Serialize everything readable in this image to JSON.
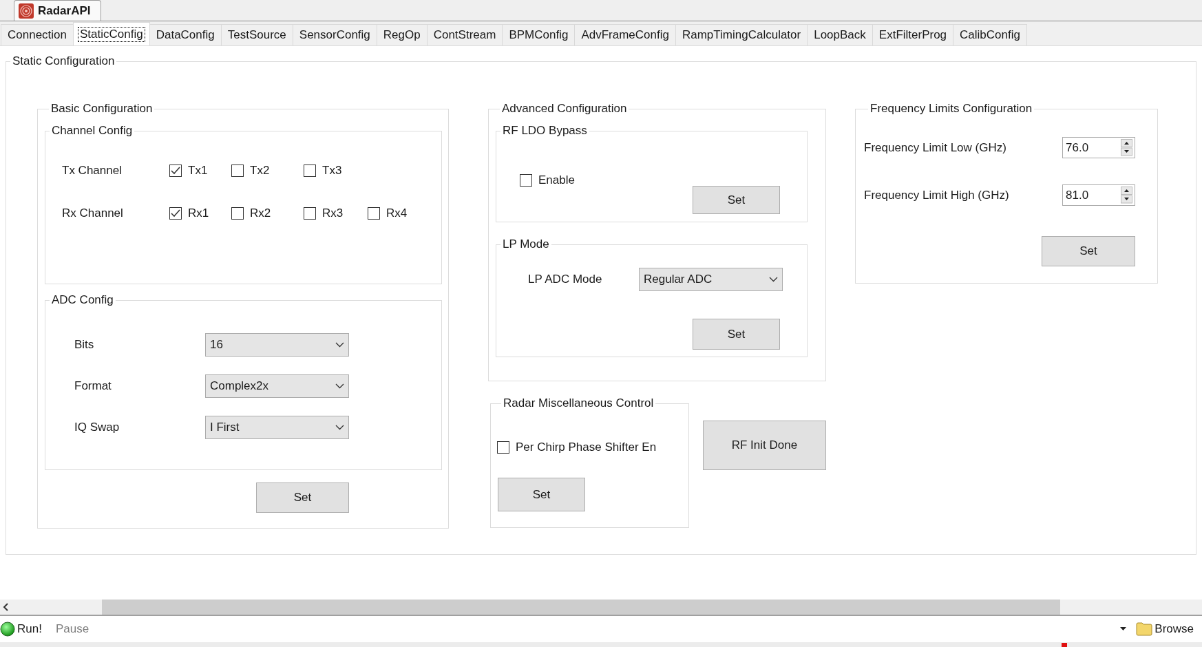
{
  "document_tab": {
    "title": "RadarAPI"
  },
  "tabs": [
    {
      "label": "Connection",
      "selected": false
    },
    {
      "label": "StaticConfig",
      "selected": true
    },
    {
      "label": "DataConfig",
      "selected": false
    },
    {
      "label": "TestSource",
      "selected": false
    },
    {
      "label": "SensorConfig",
      "selected": false
    },
    {
      "label": "RegOp",
      "selected": false
    },
    {
      "label": "ContStream",
      "selected": false
    },
    {
      "label": "BPMConfig",
      "selected": false
    },
    {
      "label": "AdvFrameConfig",
      "selected": false
    },
    {
      "label": "RampTimingCalculator",
      "selected": false
    },
    {
      "label": "LoopBack",
      "selected": false
    },
    {
      "label": "ExtFilterProg",
      "selected": false
    },
    {
      "label": "CalibConfig",
      "selected": false
    }
  ],
  "static_configuration": {
    "title": "Static Configuration",
    "basic_configuration": {
      "title": "Basic Configuration",
      "channel_config": {
        "title": "Channel Config",
        "rows": [
          {
            "label": "Tx Channel",
            "channels": [
              {
                "label": "Tx1",
                "checked": true
              },
              {
                "label": "Tx2",
                "checked": false
              },
              {
                "label": "Tx3",
                "checked": false
              }
            ]
          },
          {
            "label": "Rx Channel",
            "channels": [
              {
                "label": "Rx1",
                "checked": true
              },
              {
                "label": "Rx2",
                "checked": false
              },
              {
                "label": "Rx3",
                "checked": false
              },
              {
                "label": "Rx4",
                "checked": false
              }
            ]
          }
        ]
      },
      "adc_config": {
        "title": "ADC Config",
        "fields": [
          {
            "label": "Bits",
            "value": "16"
          },
          {
            "label": "Format",
            "value": "Complex2x"
          },
          {
            "label": "IQ Swap",
            "value": "I First"
          }
        ]
      },
      "set_button": "Set"
    },
    "advanced_configuration": {
      "title": "Advanced Configuration",
      "rf_ldo_bypass": {
        "title": "RF LDO Bypass",
        "enable": {
          "label": "Enable",
          "checked": false
        },
        "set_button": "Set"
      },
      "lp_mode": {
        "title": "LP Mode",
        "field": {
          "label": "LP ADC Mode",
          "value": "Regular ADC"
        },
        "set_button": "Set"
      }
    },
    "radar_miscellaneous_control": {
      "title": "Radar Miscellaneous Control",
      "checkbox": {
        "label": "Per Chirp Phase Shifter En",
        "checked": false
      },
      "set_button": "Set"
    },
    "rf_init_done_button": "RF Init Done",
    "frequency_limits_configuration": {
      "title": "Frequency Limits Configuration",
      "fields": [
        {
          "label": "Frequency Limit Low (GHz)",
          "value": "76.0"
        },
        {
          "label": "Frequency Limit High (GHz)",
          "value": "81.0"
        }
      ],
      "set_button": "Set"
    }
  },
  "toolbar": {
    "run_button": "Run!",
    "pause_button": {
      "label": "Pause",
      "disabled": true
    },
    "browse_button": "Browse"
  }
}
